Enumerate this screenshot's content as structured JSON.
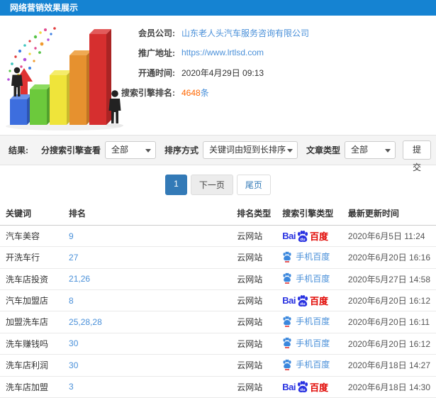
{
  "header": {
    "title": "网络营销效果展示"
  },
  "colors": {
    "header_bg": "#1583d2",
    "link_blue": "#4a90d9",
    "highlight_orange": "#ff6600",
    "pagination_active": "#337ab7",
    "baidu_blue": "#2932e1",
    "baidu_red": "#e10602"
  },
  "member_info": {
    "fields": [
      {
        "label": "会员公司:",
        "value": "山东老人头汽车服务咨询有限公司"
      },
      {
        "label": "推广地址:",
        "value": "https://www.lrtlsd.com"
      },
      {
        "label": "开通时间:",
        "value": "2020年4月29日 09:13"
      },
      {
        "label": "搜索引擎排名:",
        "value": "4648",
        "unit": "条"
      }
    ]
  },
  "illustration": {
    "description": "3d-bar-chart-with-businessmen-and-confetti",
    "bar_colors": [
      "#3d6ede",
      "#6cc93c",
      "#efe43a",
      "#e6912f",
      "#d62f2f"
    ]
  },
  "filters": {
    "result_label": "结果:",
    "engine_view_label": "分搜索引擎查看",
    "engine_view_value": "全部",
    "sort_label": "排序方式",
    "sort_value": "关键词由短到长排序",
    "article_type_label": "文章类型",
    "article_type_value": "全部",
    "submit_label": "提交"
  },
  "pagination": {
    "current_page": "1",
    "next_label": "下一页",
    "last_label": "尾页"
  },
  "table": {
    "headers": [
      "关键词",
      "排名",
      "排名类型",
      "搜索引擎类型",
      "最新更新时间"
    ],
    "engine_logos": {
      "pc": {
        "bai": "Bai",
        "du": "du",
        "cn": "百度"
      },
      "mobile": {
        "label": "手机百度"
      }
    },
    "rows": [
      {
        "keyword": "汽车美容",
        "rank": "9",
        "rank_type": "云网站",
        "engine": "pc",
        "updated": "2020年6月5日 11:24"
      },
      {
        "keyword": "开洗车行",
        "rank": "27",
        "rank_type": "云网站",
        "engine": "mobile",
        "updated": "2020年6月20日 16:16"
      },
      {
        "keyword": "洗车店投资",
        "rank": "21,26",
        "rank_type": "云网站",
        "engine": "mobile",
        "updated": "2020年5月27日 14:58"
      },
      {
        "keyword": "汽车加盟店",
        "rank": "8",
        "rank_type": "云网站",
        "engine": "pc",
        "updated": "2020年6月20日 16:12"
      },
      {
        "keyword": "加盟洗车店",
        "rank": "25,28,28",
        "rank_type": "云网站",
        "engine": "mobile",
        "updated": "2020年6月20日 16:11"
      },
      {
        "keyword": "洗车赚钱吗",
        "rank": "30",
        "rank_type": "云网站",
        "engine": "mobile",
        "updated": "2020年6月20日 16:12"
      },
      {
        "keyword": "洗车店利润",
        "rank": "30",
        "rank_type": "云网站",
        "engine": "mobile",
        "updated": "2020年6月18日 14:27"
      },
      {
        "keyword": "洗车店加盟",
        "rank": "3",
        "rank_type": "云网站",
        "engine": "pc",
        "updated": "2020年6月18日 14:30"
      }
    ]
  }
}
